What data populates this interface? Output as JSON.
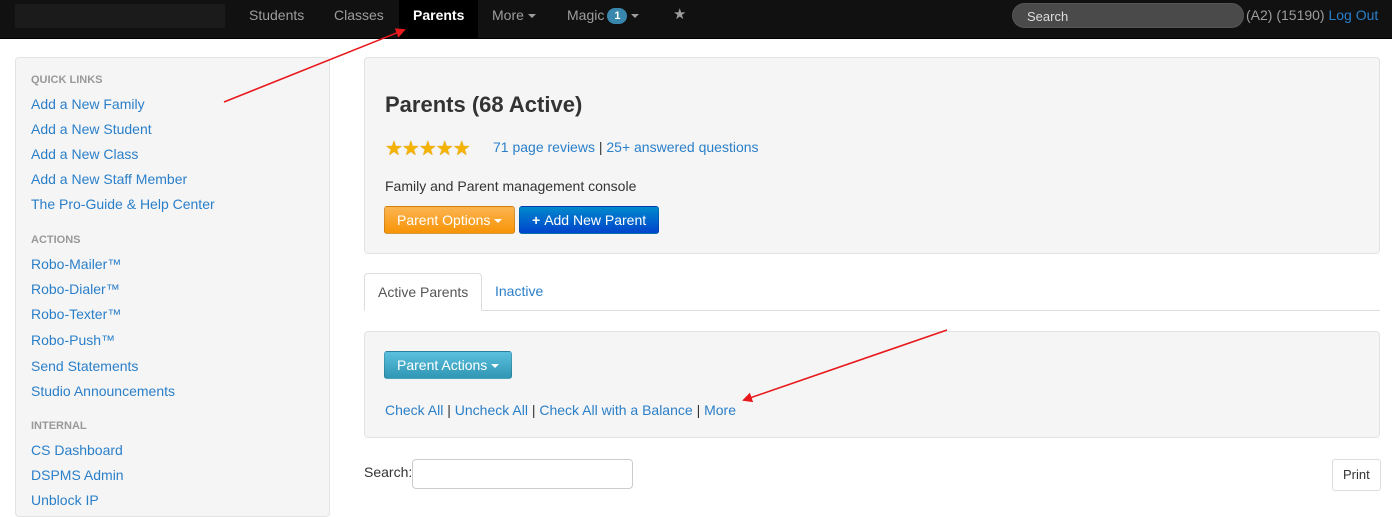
{
  "navbar": {
    "items": [
      {
        "label": "Students"
      },
      {
        "label": "Classes"
      },
      {
        "label": "Parents"
      },
      {
        "label": "More"
      },
      {
        "label": "Magic",
        "badge": "1"
      }
    ],
    "search_placeholder": "Search",
    "user_text": "(A2) (15190)",
    "logout": "Log Out"
  },
  "sidebar": {
    "sections": [
      {
        "header": "QUICK LINKS",
        "links": [
          "Add a New Family",
          "Add a New Student",
          "Add a New Class",
          "Add a New Staff Member",
          "The Pro-Guide & Help Center"
        ]
      },
      {
        "header": "ACTIONS",
        "links": [
          "Robo-Mailer™",
          "Robo-Dialer™",
          "Robo-Texter™",
          "Robo-Push™",
          "Send Statements",
          "Studio Announcements"
        ]
      },
      {
        "header": "INTERNAL",
        "links": [
          "CS Dashboard",
          "DSPMS Admin",
          "Unblock IP"
        ]
      }
    ]
  },
  "hero": {
    "title": "Parents (68 Active)",
    "rating_stars": 5,
    "reviews_link": "71 page reviews",
    "separator": "|",
    "questions_link": "25+ answered questions",
    "description": "Family and Parent management console",
    "options_button": "Parent Options",
    "add_button": "Add New Parent"
  },
  "tabs": {
    "active": "Active Parents",
    "inactive": "Inactive"
  },
  "actions": {
    "button": "Parent Actions",
    "links": {
      "check_all": "Check All",
      "uncheck_all": "Uncheck All",
      "check_balance": "Check All with a Balance",
      "more": "More"
    },
    "separator": "|"
  },
  "search": {
    "label": "Search:",
    "value": ""
  },
  "print_button": "Print",
  "colors": {
    "link": "#2a7fc9",
    "annotation_arrow": "#e8191d",
    "navbar_bg": "#111111"
  }
}
